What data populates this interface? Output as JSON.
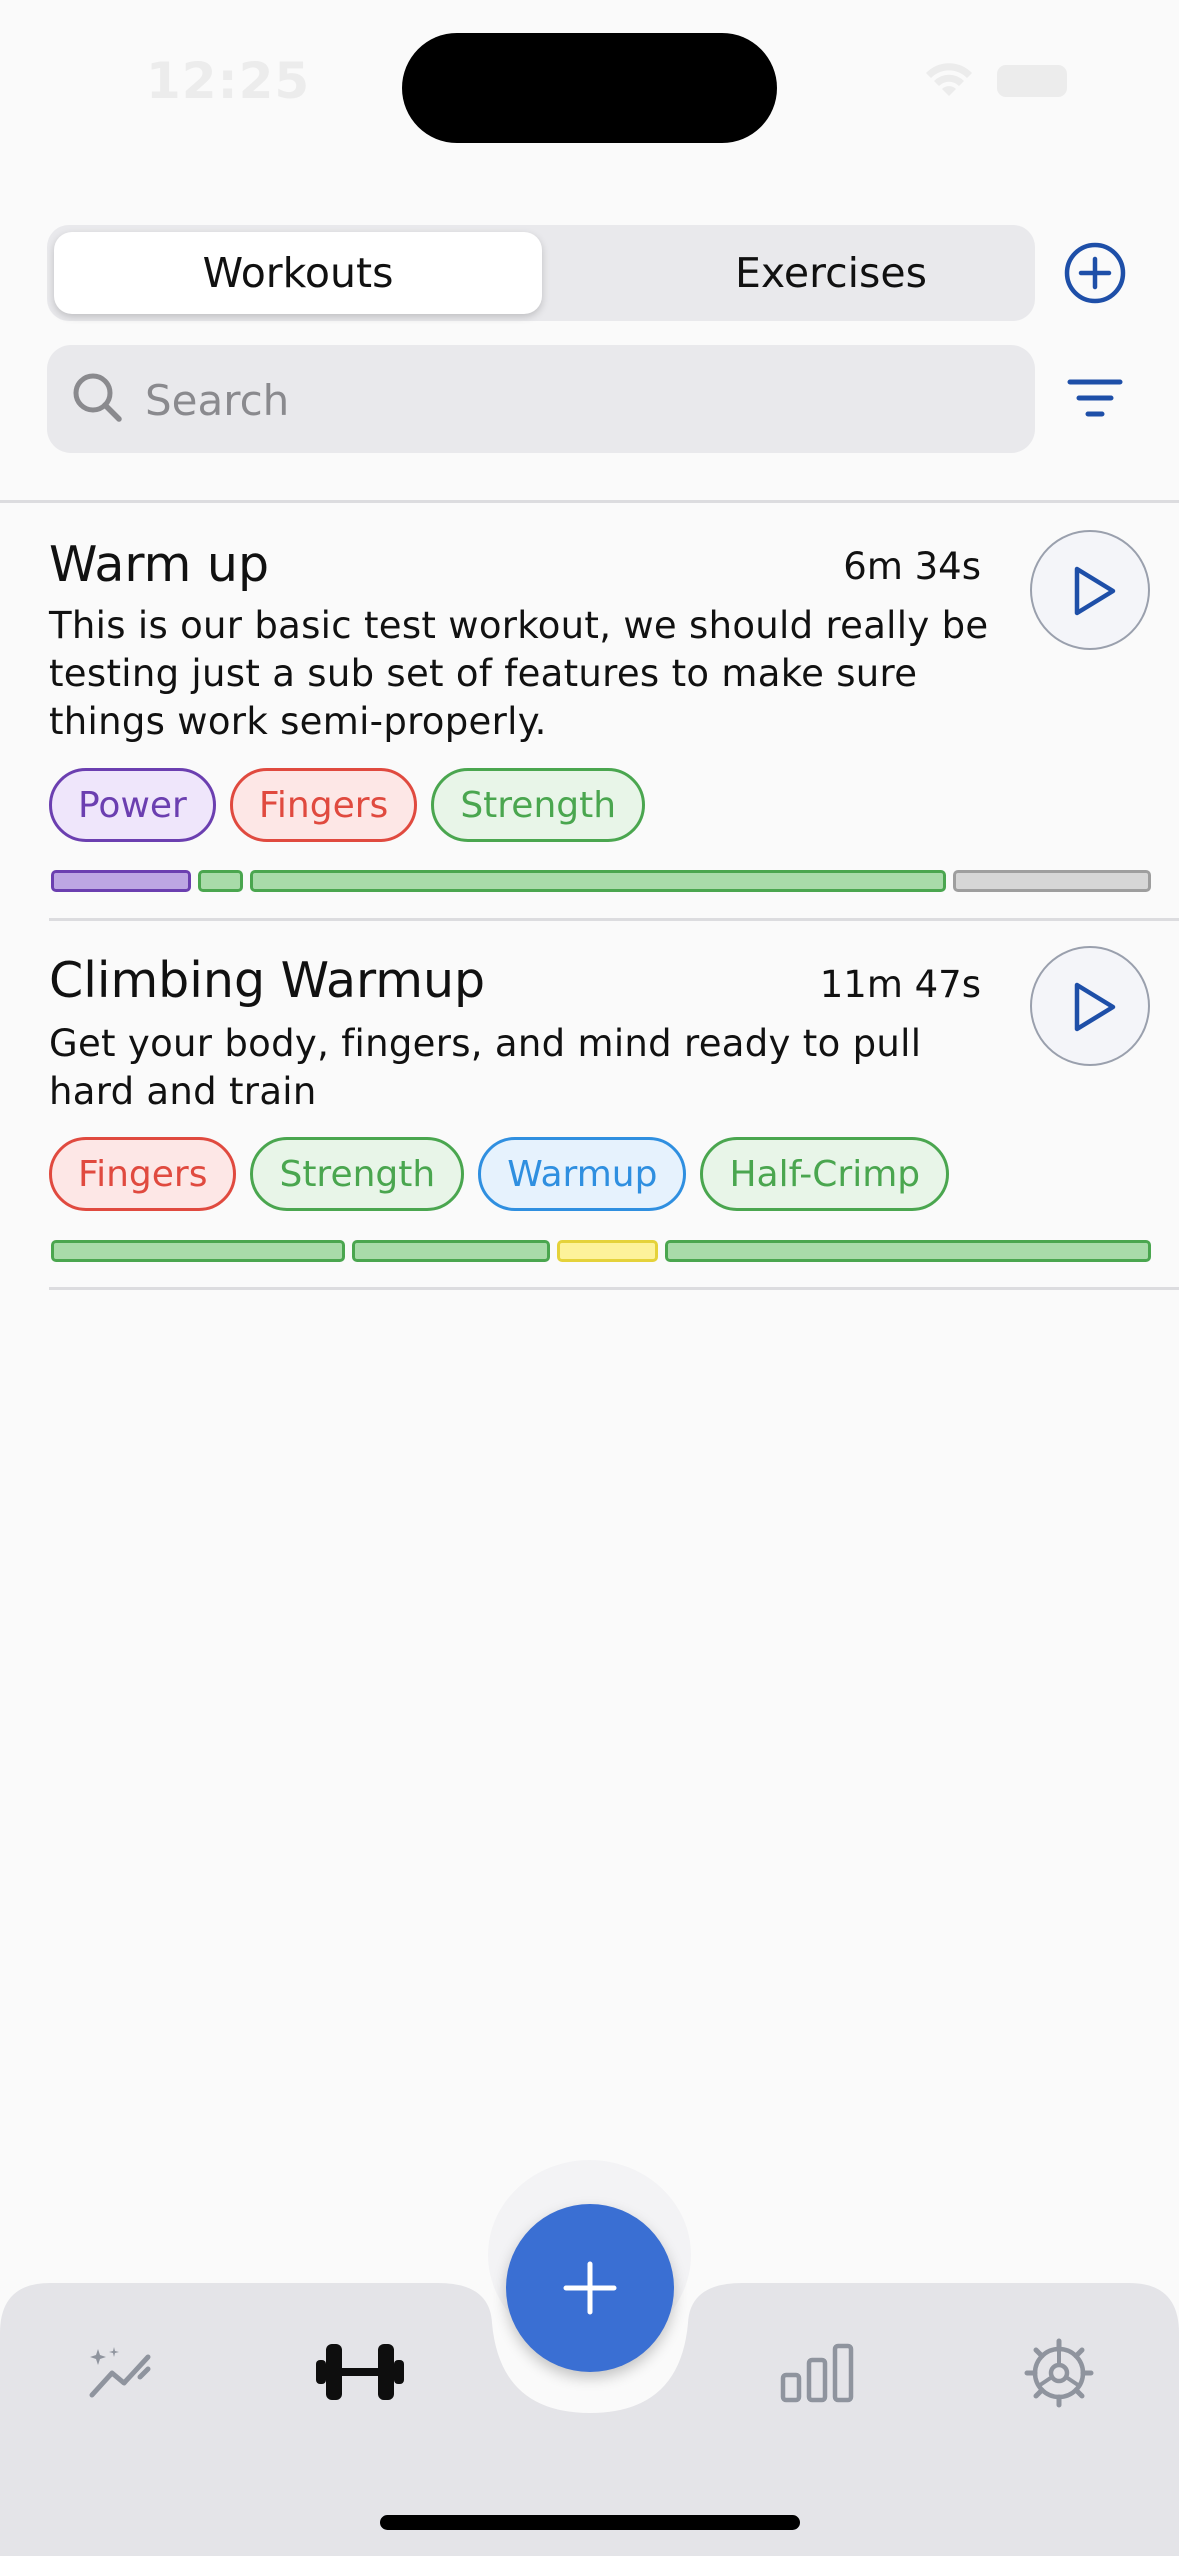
{
  "status_bar": {
    "time": "12:25"
  },
  "segmented_control": {
    "tabs": [
      {
        "label": "Workouts",
        "active": true
      },
      {
        "label": "Exercises",
        "active": false
      }
    ]
  },
  "search": {
    "placeholder": "Search",
    "value": ""
  },
  "workouts": [
    {
      "title": "Warm up",
      "duration": "6m 34s",
      "description": "This is our basic test workout, we should really be testing just a sub set of features to make sure things work semi-properly.",
      "tags": [
        {
          "label": "Power",
          "color": "#6b3fb0",
          "bg": "#efe6fb"
        },
        {
          "label": "Fingers",
          "color": "#e04a3f",
          "bg": "#fde7e6"
        },
        {
          "label": "Strength",
          "color": "#4aa64f",
          "bg": "#e8f5e8"
        }
      ],
      "segments": [
        {
          "weight": 7,
          "color": "#6b3fb0",
          "fill": "#bda6e3"
        },
        {
          "weight": 2,
          "color": "#4aa64f",
          "fill": "#a8dba9"
        },
        {
          "weight": 36,
          "color": "#4aa64f",
          "fill": "#a8dba9"
        },
        {
          "weight": 10,
          "color": "#9e9e9e",
          "fill": "#d6d6d6"
        }
      ]
    },
    {
      "title": "Climbing Warmup",
      "duration": "11m 47s",
      "description": "Get your body, fingers, and mind ready to pull hard and train",
      "tags": [
        {
          "label": "Fingers",
          "color": "#e04a3f",
          "bg": "#fde7e6"
        },
        {
          "label": "Strength",
          "color": "#4aa64f",
          "bg": "#e8f5e8"
        },
        {
          "label": "Warmup",
          "color": "#2f8fe0",
          "bg": "#e6f2fd"
        },
        {
          "label": "Half-Crimp",
          "color": "#4aa64f",
          "bg": "#e8f5e8"
        }
      ],
      "segments": [
        {
          "weight": 15,
          "color": "#4aa64f",
          "fill": "#a8dba9"
        },
        {
          "weight": 10,
          "color": "#4aa64f",
          "fill": "#a8dba9"
        },
        {
          "weight": 5,
          "color": "#e5d23a",
          "fill": "#fdf29a"
        },
        {
          "weight": 25,
          "color": "#4aa64f",
          "fill": "#a8dba9"
        }
      ]
    }
  ],
  "tab_bar": {
    "tabs": [
      {
        "icon": "sparkle-chart-icon",
        "active": false
      },
      {
        "icon": "dumbbell-icon",
        "active": true
      },
      {
        "icon": "bar-chart-icon",
        "active": false
      },
      {
        "icon": "gear-icon",
        "active": false
      }
    ],
    "fab_icon": "plus-icon"
  },
  "colors": {
    "accent": "#3a6fd3",
    "outline_icon": "#1e4fa8"
  }
}
